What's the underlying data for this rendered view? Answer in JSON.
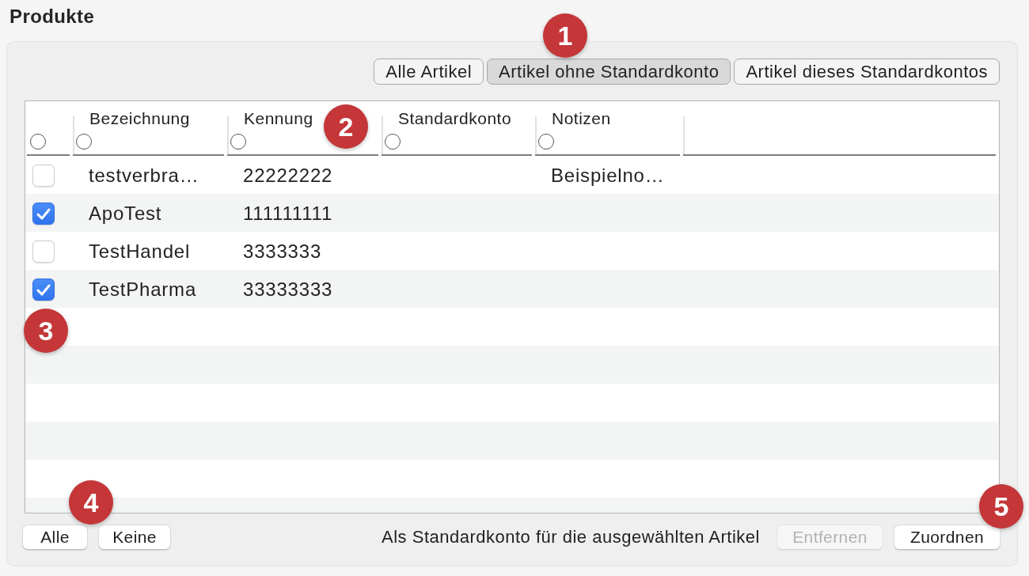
{
  "title": "Produkte",
  "filter_tabs": [
    {
      "label": "Alle Artikel",
      "selected": false
    },
    {
      "label": "Artikel ohne Standardkonto",
      "selected": true
    },
    {
      "label": "Artikel dieses Standardkontos",
      "selected": false
    }
  ],
  "table": {
    "columns": [
      {
        "radio_selected": false
      },
      {
        "label": "Bezeichnung",
        "radio_selected": false
      },
      {
        "label": "Kennung",
        "radio_selected": false
      },
      {
        "label": "Standardkonto",
        "radio_selected": false
      },
      {
        "label": "Notizen",
        "radio_selected": false
      }
    ],
    "rows": [
      {
        "checked": false,
        "bezeichnung": "testverbra…",
        "kennung": "22222222",
        "notizen": "Beispielno…"
      },
      {
        "checked": true,
        "bezeichnung": "ApoTest",
        "kennung": "111111111"
      },
      {
        "checked": false,
        "bezeichnung": "TestHandel",
        "kennung": "3333333"
      },
      {
        "checked": true,
        "bezeichnung": "TestPharma",
        "kennung": "33333333"
      }
    ]
  },
  "footer": {
    "select_buttons": [
      {
        "label": "Alle"
      },
      {
        "label": "Keine"
      }
    ],
    "assign_label": "Als Standardkonto für die ausgewählten Artikel",
    "action_buttons": [
      {
        "label": "Entfernen",
        "disabled": true
      },
      {
        "label": "Zuordnen",
        "disabled": false
      }
    ]
  },
  "callouts": [
    {
      "label": "1"
    },
    {
      "label": "2"
    },
    {
      "label": "3"
    },
    {
      "label": "4"
    },
    {
      "label": "5"
    }
  ]
}
